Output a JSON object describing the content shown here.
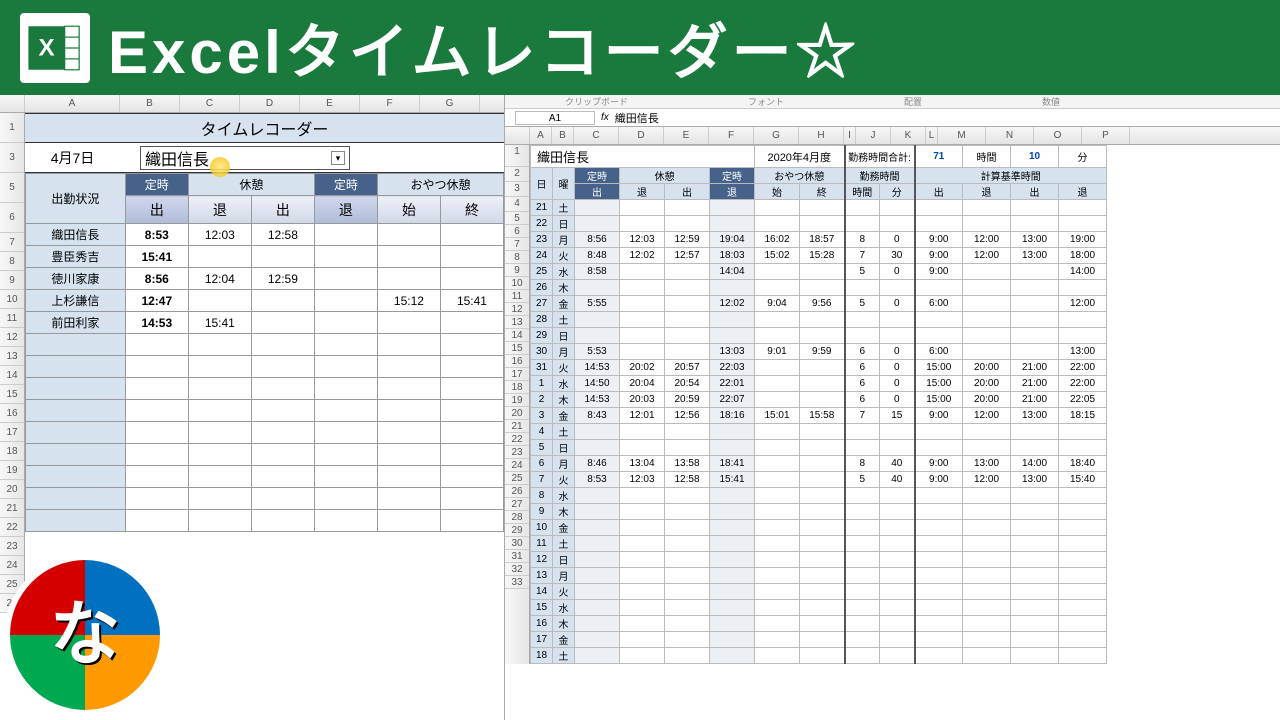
{
  "banner": {
    "title": "Excelタイムレコーダー☆"
  },
  "left": {
    "window_title": "タイムレコーダー",
    "date": "4月7日",
    "selected_name": "織田信長",
    "columns": [
      "A",
      "B",
      "C",
      "D",
      "E",
      "F",
      "G"
    ],
    "statusHeader": "出勤状況",
    "groups": {
      "teiji_in": "定時",
      "kyukei": "休憩",
      "teiji_out": "定時",
      "oyatsu": "おやつ休憩"
    },
    "buttons": {
      "in": "出",
      "kyu_out": "退",
      "kyu_in": "出",
      "out": "退",
      "o_start": "始",
      "o_end": "終"
    },
    "rows": [
      {
        "name": "織田信長",
        "in": "8:53",
        "kyu_out": "12:03",
        "kyu_in": "12:58",
        "out": "",
        "o_s": "",
        "o_e": ""
      },
      {
        "name": "豊臣秀吉",
        "in": "15:41",
        "kyu_out": "",
        "kyu_in": "",
        "out": "",
        "o_s": "",
        "o_e": ""
      },
      {
        "name": "徳川家康",
        "in": "8:56",
        "kyu_out": "12:04",
        "kyu_in": "12:59",
        "out": "",
        "o_s": "",
        "o_e": ""
      },
      {
        "name": "上杉謙信",
        "in": "12:47",
        "kyu_out": "",
        "kyu_in": "",
        "out": "",
        "o_s": "15:12",
        "o_e": "15:41"
      },
      {
        "name": "前田利家",
        "in": "14:53",
        "kyu_out": "15:41",
        "kyu_in": "",
        "out": "",
        "o_s": "",
        "o_e": ""
      }
    ]
  },
  "right": {
    "ribbon": {
      "g1": "クリップボード",
      "g2": "フォント",
      "g3": "配置",
      "g4": "数値"
    },
    "cell_ref": "A1",
    "fx_value": "織田信長",
    "columns": [
      "A",
      "B",
      "C",
      "D",
      "E",
      "F",
      "G",
      "H",
      "I",
      "J",
      "K",
      "L",
      "M",
      "N",
      "O",
      "P"
    ],
    "name": "織田信長",
    "period": "2020年4月度",
    "total_label": "勤務時間合計:",
    "total_h": "71",
    "total_h_u": "時間",
    "total_m": "10",
    "total_m_u": "分",
    "hdr": {
      "day": "日",
      "yobi": "曜",
      "teiji_in": "定時",
      "kyukei": "休憩",
      "teiji_out": "定時",
      "oyatsu": "おやつ休憩",
      "kinmu": "勤務時間",
      "calc": "計算基準時間",
      "in": "出",
      "k_out": "退",
      "k_in": "出",
      "out": "退",
      "o_s": "始",
      "o_e": "終",
      "hr": "時間",
      "mn": "分"
    },
    "timecard": [
      {
        "d": "21",
        "y": "土"
      },
      {
        "d": "22",
        "y": "日"
      },
      {
        "d": "23",
        "y": "月",
        "in": "8:56",
        "ko": "12:03",
        "ki": "12:59",
        "out": "19:04",
        "os": "16:02",
        "oe": "18:57",
        "h": "8",
        "m": "0",
        "c1": "9:00",
        "c2": "12:00",
        "c3": "13:00",
        "c4": "19:00"
      },
      {
        "d": "24",
        "y": "火",
        "in": "8:48",
        "ko": "12:02",
        "ki": "12:57",
        "out": "18:03",
        "os": "15:02",
        "oe": "15:28",
        "h": "7",
        "m": "30",
        "c1": "9:00",
        "c2": "12:00",
        "c3": "13:00",
        "c4": "18:00"
      },
      {
        "d": "25",
        "y": "水",
        "in": "8:58",
        "out": "14:04",
        "h": "5",
        "m": "0",
        "c1": "9:00",
        "c4": "14:00"
      },
      {
        "d": "26",
        "y": "木"
      },
      {
        "d": "27",
        "y": "金",
        "in": "5:55",
        "out": "12:02",
        "os": "9:04",
        "oe": "9:56",
        "h": "5",
        "m": "0",
        "c1": "6:00",
        "c4": "12:00"
      },
      {
        "d": "28",
        "y": "土"
      },
      {
        "d": "29",
        "y": "日"
      },
      {
        "d": "30",
        "y": "月",
        "in": "5:53",
        "out": "13:03",
        "os": "9:01",
        "oe": "9:59",
        "h": "6",
        "m": "0",
        "c1": "6:00",
        "c4": "13:00"
      },
      {
        "d": "31",
        "y": "火",
        "in": "14:53",
        "ko": "20:02",
        "ki": "20:57",
        "out": "22:03",
        "h": "6",
        "m": "0",
        "c1": "15:00",
        "c2": "20:00",
        "c3": "21:00",
        "c4": "22:00"
      },
      {
        "d": "1",
        "y": "水",
        "in": "14:50",
        "ko": "20:04",
        "ki": "20:54",
        "out": "22:01",
        "h": "6",
        "m": "0",
        "c1": "15:00",
        "c2": "20:00",
        "c3": "21:00",
        "c4": "22:00"
      },
      {
        "d": "2",
        "y": "木",
        "in": "14:53",
        "ko": "20:03",
        "ki": "20:59",
        "out": "22:07",
        "h": "6",
        "m": "0",
        "c1": "15:00",
        "c2": "20:00",
        "c3": "21:00",
        "c4": "22:05"
      },
      {
        "d": "3",
        "y": "金",
        "in": "8:43",
        "ko": "12:01",
        "ki": "12:56",
        "out": "18:16",
        "os": "15:01",
        "oe": "15:58",
        "h": "7",
        "m": "15",
        "c1": "9:00",
        "c2": "12:00",
        "c3": "13:00",
        "c4": "18:15"
      },
      {
        "d": "4",
        "y": "土"
      },
      {
        "d": "5",
        "y": "日"
      },
      {
        "d": "6",
        "y": "月",
        "in": "8:46",
        "ko": "13:04",
        "ki": "13:58",
        "out": "18:41",
        "h": "8",
        "m": "40",
        "c1": "9:00",
        "c2": "13:00",
        "c3": "14:00",
        "c4": "18:40"
      },
      {
        "d": "7",
        "y": "火",
        "in": "8:53",
        "ko": "12:03",
        "ki": "12:58",
        "out": "15:41",
        "h": "5",
        "m": "40",
        "c1": "9:00",
        "c2": "12:00",
        "c3": "13:00",
        "c4": "15:40"
      },
      {
        "d": "8",
        "y": "水"
      },
      {
        "d": "9",
        "y": "木"
      },
      {
        "d": "10",
        "y": "金"
      },
      {
        "d": "11",
        "y": "土"
      },
      {
        "d": "12",
        "y": "日"
      },
      {
        "d": "13",
        "y": "月"
      },
      {
        "d": "14",
        "y": "火"
      },
      {
        "d": "15",
        "y": "水"
      },
      {
        "d": "16",
        "y": "木"
      },
      {
        "d": "17",
        "y": "金"
      },
      {
        "d": "18",
        "y": "土"
      }
    ]
  }
}
